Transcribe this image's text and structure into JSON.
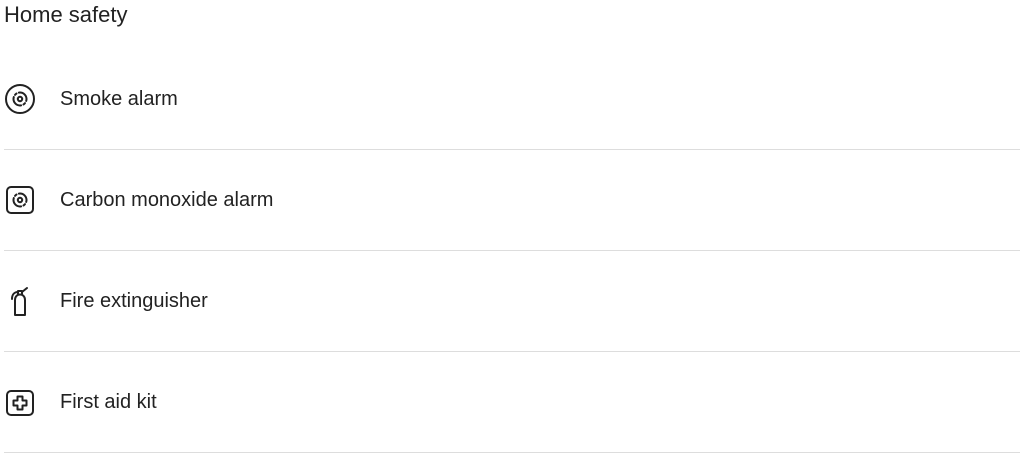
{
  "section": {
    "title": "Home safety",
    "items": [
      {
        "label": "Smoke alarm",
        "icon": "smoke-alarm-icon"
      },
      {
        "label": "Carbon monoxide alarm",
        "icon": "carbon-monoxide-alarm-icon"
      },
      {
        "label": "Fire extinguisher",
        "icon": "fire-extinguisher-icon"
      },
      {
        "label": "First aid kit",
        "icon": "first-aid-kit-icon"
      }
    ]
  }
}
